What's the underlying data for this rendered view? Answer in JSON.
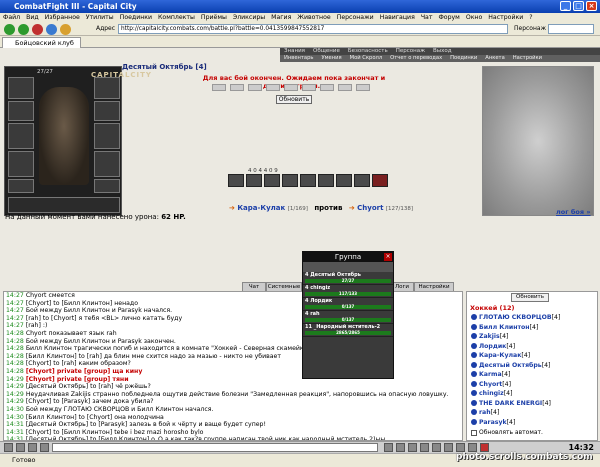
{
  "window": {
    "title": "CombatFight III - Capital City"
  },
  "menu": [
    "Файл",
    "Вид",
    "Избранное",
    "Утилиты",
    "Поединки",
    "Комплекты",
    "Приёмы",
    "Эликсиры",
    "Магия",
    "Животное",
    "Персонажи",
    "Навигация",
    "Чат",
    "Форум",
    "Окно",
    "Настройки",
    "?"
  ],
  "nav": {
    "address_label": "Адрес",
    "address": "http://capitalcity.combats.com/battle.pl?battle=0.0413599847552817",
    "search_label": "Персонаж"
  },
  "tab": {
    "label": "Бойцовский клуб"
  },
  "topnav1": [
    "Знания",
    "Общение",
    "Безопасность",
    "Персонаж",
    "Выход"
  ],
  "topnav2": [
    "Инвентарь",
    "Умения",
    "Мой Скролл",
    "Отчет о переводах",
    "Поединки",
    "Анкета",
    "Настройки"
  ],
  "character": {
    "level": "[4]",
    "hp": "27/27",
    "logo": "CAPITALCITY"
  },
  "battle": {
    "banner": "Десятый Октябрь [4]",
    "message": "Для вас бой окончен. Ожидаем пока закончат и другие игроки...",
    "refresh_label": "Обновить"
  },
  "stats": {
    "text": "4  0  4  4  0  9"
  },
  "versus": {
    "player1": "Кара-Кулак",
    "hp1": "[1/169]",
    "vs": "против",
    "player2": "Chyort",
    "hp2": "[127/138]"
  },
  "battle_log_link": "лог боя »",
  "damage": {
    "prefix": "На данный момент вами нанесено урона:",
    "value": "62 HP."
  },
  "group": {
    "title": "Группа",
    "members": [
      {
        "name": "4  Десятый Октябрь",
        "hp": "27/27"
      },
      {
        "name": "4  chingiz",
        "hp": "117/133"
      },
      {
        "name": "4  Лордик",
        "hp": "0/137"
      },
      {
        "name": "4  rah",
        "hp": "0/137"
      },
      {
        "name": "11  _Народный мститель-2",
        "hp": "2865/2865"
      }
    ]
  },
  "chat_tabs": [
    "Чат",
    "Системные",
    "Логи",
    "Настройки"
  ],
  "chat": [
    {
      "t": "14:27",
      "text": "Chyort смеется"
    },
    {
      "t": "14:27",
      "text": "[Chyort] to [Билл Клинтон] ненадо"
    },
    {
      "t": "14:27",
      "text": "Бой между Билл Клинтон и Parasyk начался."
    },
    {
      "t": "14:27",
      "text": "[rah] to [Chyort] я тебя <BL> лично катать буду"
    },
    {
      "t": "14:27",
      "text": "[rah] :)"
    },
    {
      "t": "14:28",
      "text": "Chyort показывает язык rah"
    },
    {
      "t": "14:28",
      "text": "Бой между Билл Клинтон и Parasyk закончен."
    },
    {
      "t": "14:28",
      "text": "Билл Клинтон трагически погиб и находится в комнате \"Хоккей - Северная скамейка\""
    },
    {
      "t": "14:28",
      "text": "[Билл Клинтон] to [rah] да блин мне схится надо за мазью - никто не убивает"
    },
    {
      "t": "14:28",
      "text": "[Chyort] to [rah] каким образом?"
    },
    {
      "t": "14:28",
      "text": "[Chyort] private [group] ща кину"
    },
    {
      "t": "14:29",
      "text": "[Chyort] private [group] тяни"
    },
    {
      "t": "14:29",
      "text": "[Десятый Октябрь] to [rah] чё ржёшь?"
    },
    {
      "t": "14:29",
      "text": "Неудачливая Zakijis странно побледнела ощутив действие болезни \"Замедленная реакция\", напоровшись на опасную ловушку."
    },
    {
      "t": "14:29",
      "text": "[Chyort] to [Parasyk] зачем дока убила?"
    },
    {
      "t": "14:30",
      "text": "Бой между ГЛОТАЮ СКВОРЦОВ и Билл Клинтон начался."
    },
    {
      "t": "14:30",
      "text": "[Билл Клинтон] to [Chyort] она молодчина"
    },
    {
      "t": "14:31",
      "text": "[Десятый Октябрь] to [Parasyk] залезь в бой к чёрту и ваще будет супер!"
    },
    {
      "t": "14:31",
      "text": "[Chyort] to [Билл Клинтон] tebe i bez mazi horosho bylo"
    },
    {
      "t": "14:31",
      "text": "[Десятый Октябрь] to [Билл Клинтон] o_O а как так?в группе написан твой ник как народный мститель 2)ыы"
    }
  ],
  "userlist": {
    "refresh_label": "Обновить",
    "room": "Хоккей (12)",
    "users": [
      {
        "name": "ГЛОТАЮ СКВОРЦОВ",
        "lvl": "[4]"
      },
      {
        "name": "Билл Клинтон",
        "lvl": "[4]"
      },
      {
        "name": "Zakjis",
        "lvl": "[4]"
      },
      {
        "name": "Лордик",
        "lvl": "[4]"
      },
      {
        "name": "Кара-Кулак",
        "lvl": "[4]"
      },
      {
        "name": "Десятый Октябрь",
        "lvl": "[4]"
      },
      {
        "name": "Karma",
        "lvl": "[4]"
      },
      {
        "name": "Chyort",
        "lvl": "[4]"
      },
      {
        "name": "chingiz",
        "lvl": "[4]"
      },
      {
        "name": "THE DARK ENERGI",
        "lvl": "[4]"
      },
      {
        "name": "rah",
        "lvl": "[4]"
      },
      {
        "name": "Parasyk",
        "lvl": "[4]"
      }
    ],
    "auto_label": "Обновлять автомат."
  },
  "clock": "14:32",
  "status": {
    "text": "Готово"
  },
  "watermark": "photo.scrolls.combats.com"
}
